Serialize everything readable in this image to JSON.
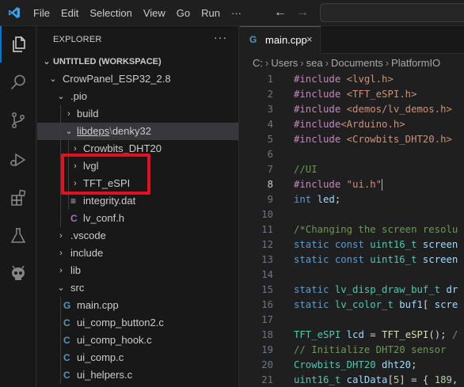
{
  "menu": [
    "File",
    "Edit",
    "Selection",
    "View",
    "Go",
    "Run",
    "···"
  ],
  "sidebar": {
    "title": "EXPLORER",
    "more": "···",
    "workspace": "UNTITLED (WORKSPACE)",
    "project": "CrowPanel_ESP32_2.8",
    "pio": ".pio",
    "build": "build",
    "libdeps": "libdeps",
    "libdeps_sep": "\\",
    "denky": "denky32",
    "crowbits": "Crowbits_DHT20",
    "lvgl": "lvgl",
    "tft": "TFT_eSPI",
    "integrity": "integrity.dat",
    "lv_conf": "lv_conf.h",
    "vscode": ".vscode",
    "include": "include",
    "lib": "lib",
    "src": "src",
    "files": [
      "main.cpp",
      "ui_comp_button2.c",
      "ui_comp_hook.c",
      "ui_comp.c",
      "ui_helpers.c"
    ]
  },
  "editor": {
    "tab_label": "main.cpp",
    "tab_close": "×",
    "breadcrumb": [
      "C:",
      "Users",
      "sea",
      "Documents",
      "PlatformIO"
    ],
    "line_numbers": [
      "1",
      "2",
      "3",
      "4",
      "5",
      "6",
      "7",
      "8",
      "9",
      "10",
      "11",
      "12",
      "13",
      "14",
      "15",
      "16",
      "17",
      "18",
      "19",
      "20",
      "21"
    ],
    "current_line": "8",
    "code": {
      "l1_kw": "#include",
      "l1_str": " <lvgl.h>",
      "l2_kw": "#include",
      "l2_str": " <TFT_eSPI.h>",
      "l3_kw": "#include",
      "l3_str": " <demos/lv_demos.h>",
      "l4_kw": "#include",
      "l4_str": "<Arduino.h>",
      "l5_kw": "#include",
      "l5_str": " <Crowbits_DHT20.h>",
      "l7_cm": "//UI",
      "l8_kw": "#include",
      "l8_str": " \"ui.h\"",
      "l9_ty": "int",
      "l9_va": " led",
      "l9_op": ";",
      "l11_cm": "/*Changing the screen resolu",
      "l12_kw": "static const",
      "l12_ty": " uint16_t",
      "l12_va": " screen",
      "l13_kw": "static const",
      "l13_ty": " uint16_t",
      "l13_va": " screen",
      "l15_kw": "static",
      "l15_ty": " lv_disp_draw_buf_t",
      "l15_va": " dr",
      "l16_kw": "static",
      "l16_ty": " lv_color_t",
      "l16_va": " buf1",
      "l16_op": "[ ",
      "l16_va2": "scre",
      "l18_ty": "TFT_eSPI",
      "l18_va": " lcd",
      "l18_op": " = ",
      "l18_fn": "TFT_eSPI",
      "l18_op2": "(); ",
      "l18_cm": "/",
      "l19_cm": "// Initialize DHT20 sensor",
      "l20_ty": "Crowbits_DHT20",
      "l20_va": " dht20",
      "l20_op": ";",
      "l21_ty": "uint16_t",
      "l21_va": " calData",
      "l21_op": "[",
      "l21_nm": "5",
      "l21_op2": "] = { ",
      "l21_nm2": "189",
      "l21_op3": ","
    }
  },
  "colors": {
    "accent": "#0078d4",
    "highlight": "#e3111f",
    "vscode_blue": "#3ca4ee"
  }
}
